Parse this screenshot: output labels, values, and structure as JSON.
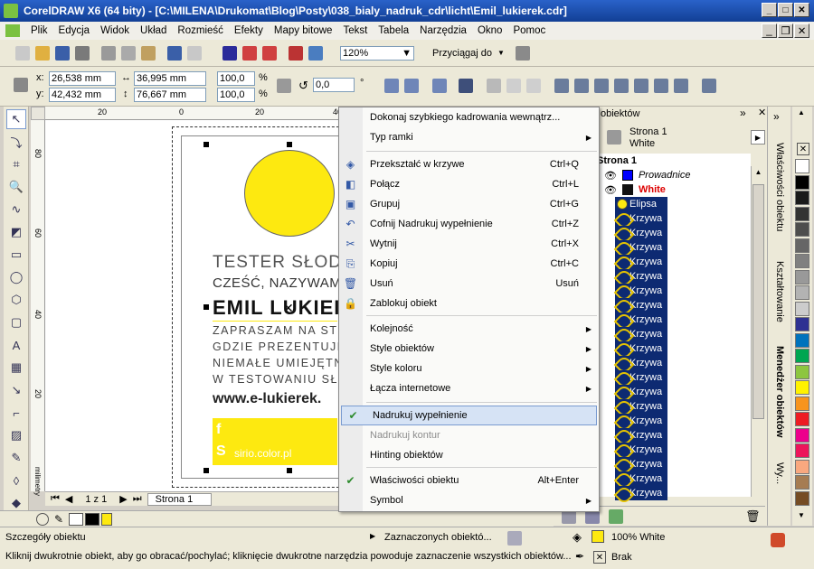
{
  "app": {
    "title": "CorelDRAW X6 (64 bity) - [C:\\MILENA\\Drukomat\\Blog\\Posty\\038_bialy_nadruk_cdr\\licht\\Emil_lukierek.cdr]"
  },
  "menu": [
    "Plik",
    "Edycja",
    "Widok",
    "Układ",
    "Rozmieść",
    "Efekty",
    "Mapy bitowe",
    "Tekst",
    "Tabela",
    "Narzędzia",
    "Okno",
    "Pomoc"
  ],
  "toolbar": {
    "zoom": "120%",
    "snap_label": "Przyciągaj do"
  },
  "propbar": {
    "x_label": "x:",
    "x": "26,538 mm",
    "y_label": "y:",
    "y": "42,432 mm",
    "w": "36,995 mm",
    "h": "76,667 mm",
    "sx": "100,0",
    "sy": "100,0",
    "pct": "%",
    "angle": "0,0",
    "deg": "°"
  },
  "ruler": {
    "h_ticks": [
      "20",
      "0",
      "20",
      "40"
    ],
    "v_ticks": [
      "80",
      "60",
      "40",
      "20"
    ],
    "unit": "milimetry"
  },
  "artwork": {
    "line1": "TESTER SŁODY",
    "line2": "CZEŚĆ, NAZYWAM",
    "name": "EMIL LUKIEI",
    "p1": "ZAPRASZAM NA ST",
    "p2": "GDZIE PREZENTUJĘ S",
    "p3": "NIEMAŁE UMIEJĘTN",
    "p4": "W TESTOWANIU SŁO",
    "url": "www.e-lukierek.",
    "bar_text": "sirio.color.pl",
    "accent": "#fde910"
  },
  "nav": {
    "page_of": "1 z 1",
    "page_tab": "Strona 1"
  },
  "context_menu": {
    "items": [
      {
        "label": "Dokonaj szybkiego kadrowania wewnątrz...",
        "shortcut": "",
        "icon": "",
        "submenu": false,
        "disabled": false
      },
      {
        "label": "Typ ramki",
        "shortcut": "",
        "icon": "",
        "submenu": true,
        "disabled": false
      },
      {
        "label": "Przekształć w krzywe",
        "shortcut": "Ctrl+Q",
        "icon": "◈",
        "submenu": false,
        "disabled": false
      },
      {
        "label": "Połącz",
        "shortcut": "Ctrl+L",
        "icon": "◧",
        "submenu": false,
        "disabled": false
      },
      {
        "label": "Grupuj",
        "shortcut": "Ctrl+G",
        "icon": "▣",
        "submenu": false,
        "disabled": false
      },
      {
        "label": "Cofnij Nadrukuj wypełnienie",
        "shortcut": "Ctrl+Z",
        "icon": "↶",
        "submenu": false,
        "disabled": false
      },
      {
        "label": "Wytnij",
        "shortcut": "Ctrl+X",
        "icon": "✂",
        "submenu": false,
        "disabled": false
      },
      {
        "label": "Kopiuj",
        "shortcut": "Ctrl+C",
        "icon": "⎘",
        "submenu": false,
        "disabled": false
      },
      {
        "label": "Usuń",
        "shortcut": "Usuń",
        "icon": "🗑",
        "submenu": false,
        "disabled": false
      },
      {
        "label": "Zablokuj obiekt",
        "shortcut": "",
        "icon": "🔒",
        "submenu": false,
        "disabled": false
      },
      {
        "label": "Kolejność",
        "shortcut": "",
        "icon": "",
        "submenu": true,
        "disabled": false
      },
      {
        "label": "Style obiektów",
        "shortcut": "",
        "icon": "",
        "submenu": true,
        "disabled": false
      },
      {
        "label": "Style koloru",
        "shortcut": "",
        "icon": "",
        "submenu": true,
        "disabled": false
      },
      {
        "label": "Łącza internetowe",
        "shortcut": "",
        "icon": "",
        "submenu": true,
        "disabled": false
      },
      {
        "label": "Nadrukuj wypełnienie",
        "shortcut": "",
        "icon": "✔",
        "submenu": false,
        "disabled": false
      },
      {
        "label": "Nadrukuj kontur",
        "shortcut": "",
        "icon": "",
        "submenu": false,
        "disabled": true
      },
      {
        "label": "Hinting obiektów",
        "shortcut": "",
        "icon": "",
        "submenu": false,
        "disabled": false
      },
      {
        "label": "Właściwości obiektu",
        "shortcut": "Alt+Enter",
        "icon": "✔",
        "submenu": false,
        "disabled": false
      },
      {
        "label": "Symbol",
        "shortcut": "",
        "icon": "",
        "submenu": true,
        "disabled": false
      }
    ]
  },
  "object_manager": {
    "header": "obiektów",
    "page_name": "Strona 1",
    "layer_name": "White",
    "tree_page": "Strona 1",
    "guides": "Prowadnice",
    "white_layer": "White",
    "ellipse": "Elipsa",
    "curve": "Krzywa",
    "curve_rows": 20
  },
  "dockers": {
    "tab1": "Właściwości obiektu",
    "tab2": "Kształtowanie",
    "tab3": "Menedżer obiektów",
    "tab4": "Wy..."
  },
  "palette": [
    "#ffffff",
    "#000000",
    "#1a1a1a",
    "#333333",
    "#4d4d4d",
    "#666666",
    "#808080",
    "#999999",
    "#b3b3b3",
    "#cccccc",
    "#2e3192",
    "#0072bc",
    "#00a651",
    "#8dc63f",
    "#fff200",
    "#f7941d",
    "#ed1c24",
    "#ec008c",
    "#ed145b",
    "#f9a87f",
    "#a67c52",
    "#754c24"
  ],
  "status": {
    "details": "Szczegóły obiektu",
    "selected": "Zaznaczonych obiektó...",
    "fill": "100% White",
    "outline": "Brak",
    "hint": "Kliknij dwukrotnie obiekt, aby go obracać/pochylać; kliknięcie dwukrotne narzędzia powoduje zaznaczenie wszystkich obiektów..."
  }
}
